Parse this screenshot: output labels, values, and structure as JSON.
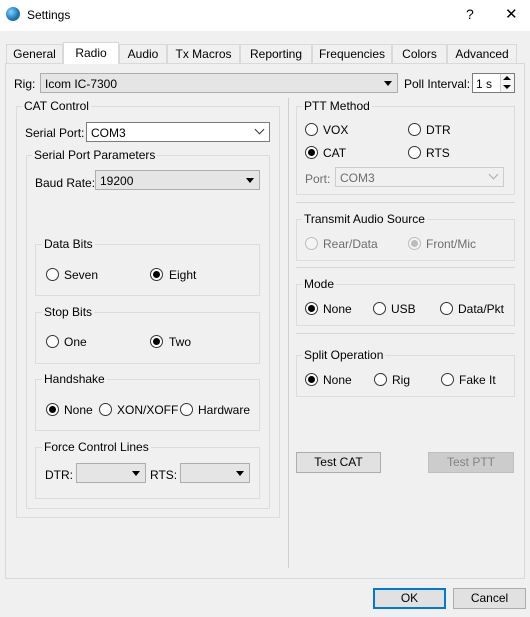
{
  "window": {
    "title": "Settings",
    "help_glyph": "?",
    "close_glyph": "✕"
  },
  "tabs": [
    {
      "label": "General"
    },
    {
      "label": "Radio"
    },
    {
      "label": "Audio"
    },
    {
      "label": "Tx Macros"
    },
    {
      "label": "Reporting"
    },
    {
      "label": "Frequencies"
    },
    {
      "label": "Colors"
    },
    {
      "label": "Advanced"
    }
  ],
  "active_tab": "Radio",
  "rig": {
    "label": "Rig:",
    "value": "Icom IC-7300",
    "poll_label": "Poll Interval:",
    "poll_value": "1 s"
  },
  "cat": {
    "title": "CAT Control",
    "serial_port_label": "Serial Port:",
    "serial_port_value": "COM3",
    "params_title": "Serial Port Parameters",
    "baud_label": "Baud Rate:",
    "baud_value": "19200",
    "data_bits": {
      "title": "Data Bits",
      "options": [
        "Seven",
        "Eight"
      ],
      "selected": "Eight"
    },
    "stop_bits": {
      "title": "Stop Bits",
      "options": [
        "One",
        "Two"
      ],
      "selected": "Two"
    },
    "handshake": {
      "title": "Handshake",
      "options": [
        "None",
        "XON/XOFF",
        "Hardware"
      ],
      "selected": "None"
    },
    "force": {
      "title": "Force Control Lines",
      "dtr_label": "DTR:",
      "dtr_value": "",
      "rts_label": "RTS:",
      "rts_value": ""
    }
  },
  "ptt": {
    "title": "PTT Method",
    "options": [
      "VOX",
      "DTR",
      "CAT",
      "RTS"
    ],
    "selected": "CAT",
    "port_label": "Port:",
    "port_value": "COM3"
  },
  "tx_audio": {
    "title": "Transmit Audio Source",
    "options": [
      "Rear/Data",
      "Front/Mic"
    ],
    "selected": "Front/Mic"
  },
  "mode": {
    "title": "Mode",
    "options": [
      "None",
      "USB",
      "Data/Pkt"
    ],
    "selected": "None"
  },
  "split": {
    "title": "Split Operation",
    "options": [
      "None",
      "Rig",
      "Fake It"
    ],
    "selected": "None"
  },
  "buttons": {
    "test_cat": "Test CAT",
    "test_ptt": "Test PTT",
    "ok": "OK",
    "cancel": "Cancel"
  }
}
